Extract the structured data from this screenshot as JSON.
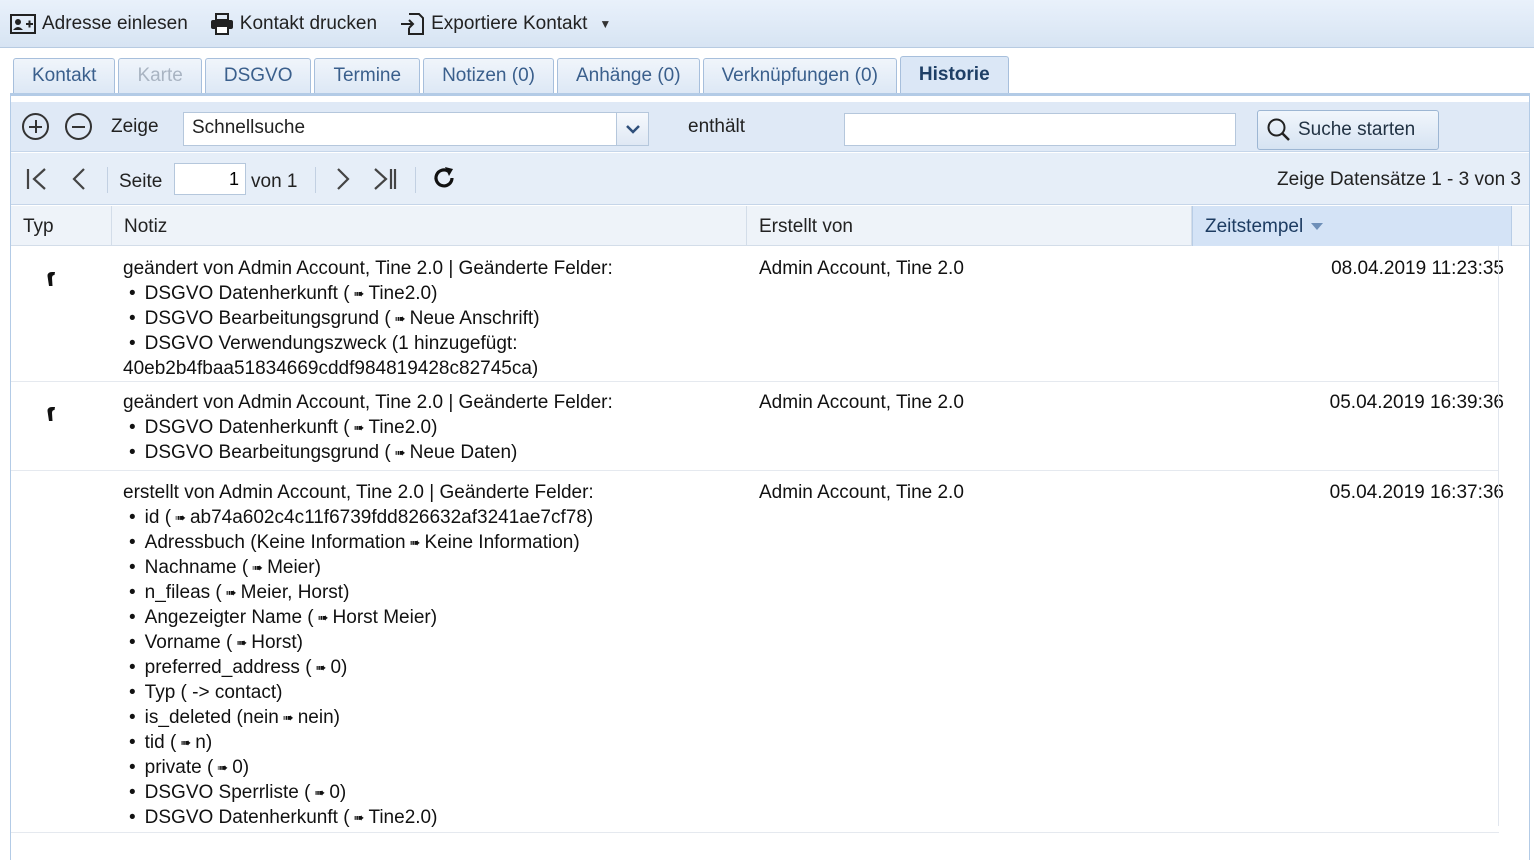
{
  "toolbar": {
    "import_label": "Adresse einlesen",
    "print_label": "Kontakt drucken",
    "export_label": "Exportiere Kontakt"
  },
  "tabs": [
    {
      "label": "Kontakt",
      "state": "normal"
    },
    {
      "label": "Karte",
      "state": "disabled"
    },
    {
      "label": "DSGVO",
      "state": "normal"
    },
    {
      "label": "Termine",
      "state": "normal"
    },
    {
      "label": "Notizen (0)",
      "state": "normal"
    },
    {
      "label": "Anhänge (0)",
      "state": "normal"
    },
    {
      "label": "Verknüpfungen (0)",
      "state": "normal"
    },
    {
      "label": "Historie",
      "state": "active"
    }
  ],
  "filter": {
    "show_label": "Zeige",
    "field_value": "Schnellsuche",
    "operator_label": "enthält",
    "search_value": "",
    "search_button": "Suche starten"
  },
  "paging": {
    "page_label": "Seite",
    "page_value": "1",
    "of_label": "von 1",
    "info": "Zeige Datensätze 1 - 3 von 3"
  },
  "grid": {
    "columns": {
      "typ": "Typ",
      "notiz": "Notiz",
      "erstellt_von": "Erstellt von",
      "zeitstempel": "Zeitstempel"
    },
    "rows": [
      {
        "has_icon": true,
        "heading": "geändert von Admin Account, Tine 2.0 | Geänderte Felder:",
        "items": [
          {
            "prefix": "DSGVO Datenherkunft (",
            "arrow": true,
            "suffix": "Tine2.0)"
          },
          {
            "prefix": "DSGVO Bearbeitungsgrund (",
            "arrow": true,
            "suffix": "Neue Anschrift)"
          },
          {
            "prefix": "DSGVO Verwendungszweck (1 hinzugefügt:",
            "arrow": false,
            "suffix": ""
          }
        ],
        "continuation": "40eb2b4fbaa51834669cddf984819428c82745ca)",
        "creator": "Admin Account, Tine 2.0",
        "timestamp": "08.04.2019 11:23:35"
      },
      {
        "has_icon": true,
        "heading": "geändert von Admin Account, Tine 2.0 | Geänderte Felder:",
        "items": [
          {
            "prefix": "DSGVO Datenherkunft (",
            "arrow": true,
            "suffix": "Tine2.0)"
          },
          {
            "prefix": "DSGVO Bearbeitungsgrund (",
            "arrow": true,
            "suffix": "Neue Daten)"
          }
        ],
        "continuation": "",
        "creator": "Admin Account, Tine 2.0",
        "timestamp": "05.04.2019 16:39:36"
      },
      {
        "has_icon": false,
        "heading": "erstellt von Admin Account, Tine 2.0 | Geänderte Felder:",
        "items": [
          {
            "prefix": "id (",
            "arrow": true,
            "suffix": "ab74a602c4c11f6739fdd826632af3241ae7cf78)"
          },
          {
            "prefix": "Adressbuch (Keine Information",
            "arrow": true,
            "suffix": "Keine Information)"
          },
          {
            "prefix": "Nachname (",
            "arrow": true,
            "suffix": "Meier)"
          },
          {
            "prefix": "n_fileas (",
            "arrow": true,
            "suffix": "Meier, Horst)"
          },
          {
            "prefix": "Angezeigter Name (",
            "arrow": true,
            "suffix": "Horst Meier)"
          },
          {
            "prefix": "Vorname (",
            "arrow": true,
            "suffix": "Horst)"
          },
          {
            "prefix": "preferred_address (",
            "arrow": true,
            "suffix": "0)"
          },
          {
            "prefix": "Typ ( -> contact)",
            "arrow": false,
            "suffix": ""
          },
          {
            "prefix": "is_deleted (nein",
            "arrow": true,
            "suffix": "nein)"
          },
          {
            "prefix": "tid (",
            "arrow": true,
            "suffix": "n)"
          },
          {
            "prefix": "private (",
            "arrow": true,
            "suffix": "0)"
          },
          {
            "prefix": "DSGVO Sperrliste (",
            "arrow": true,
            "suffix": "0)"
          },
          {
            "prefix": "DSGVO Datenherkunft (",
            "arrow": true,
            "suffix": "Tine2.0)"
          }
        ],
        "continuation": "",
        "creator": "Admin Account, Tine 2.0",
        "timestamp": "05.04.2019 16:37:36"
      }
    ]
  }
}
